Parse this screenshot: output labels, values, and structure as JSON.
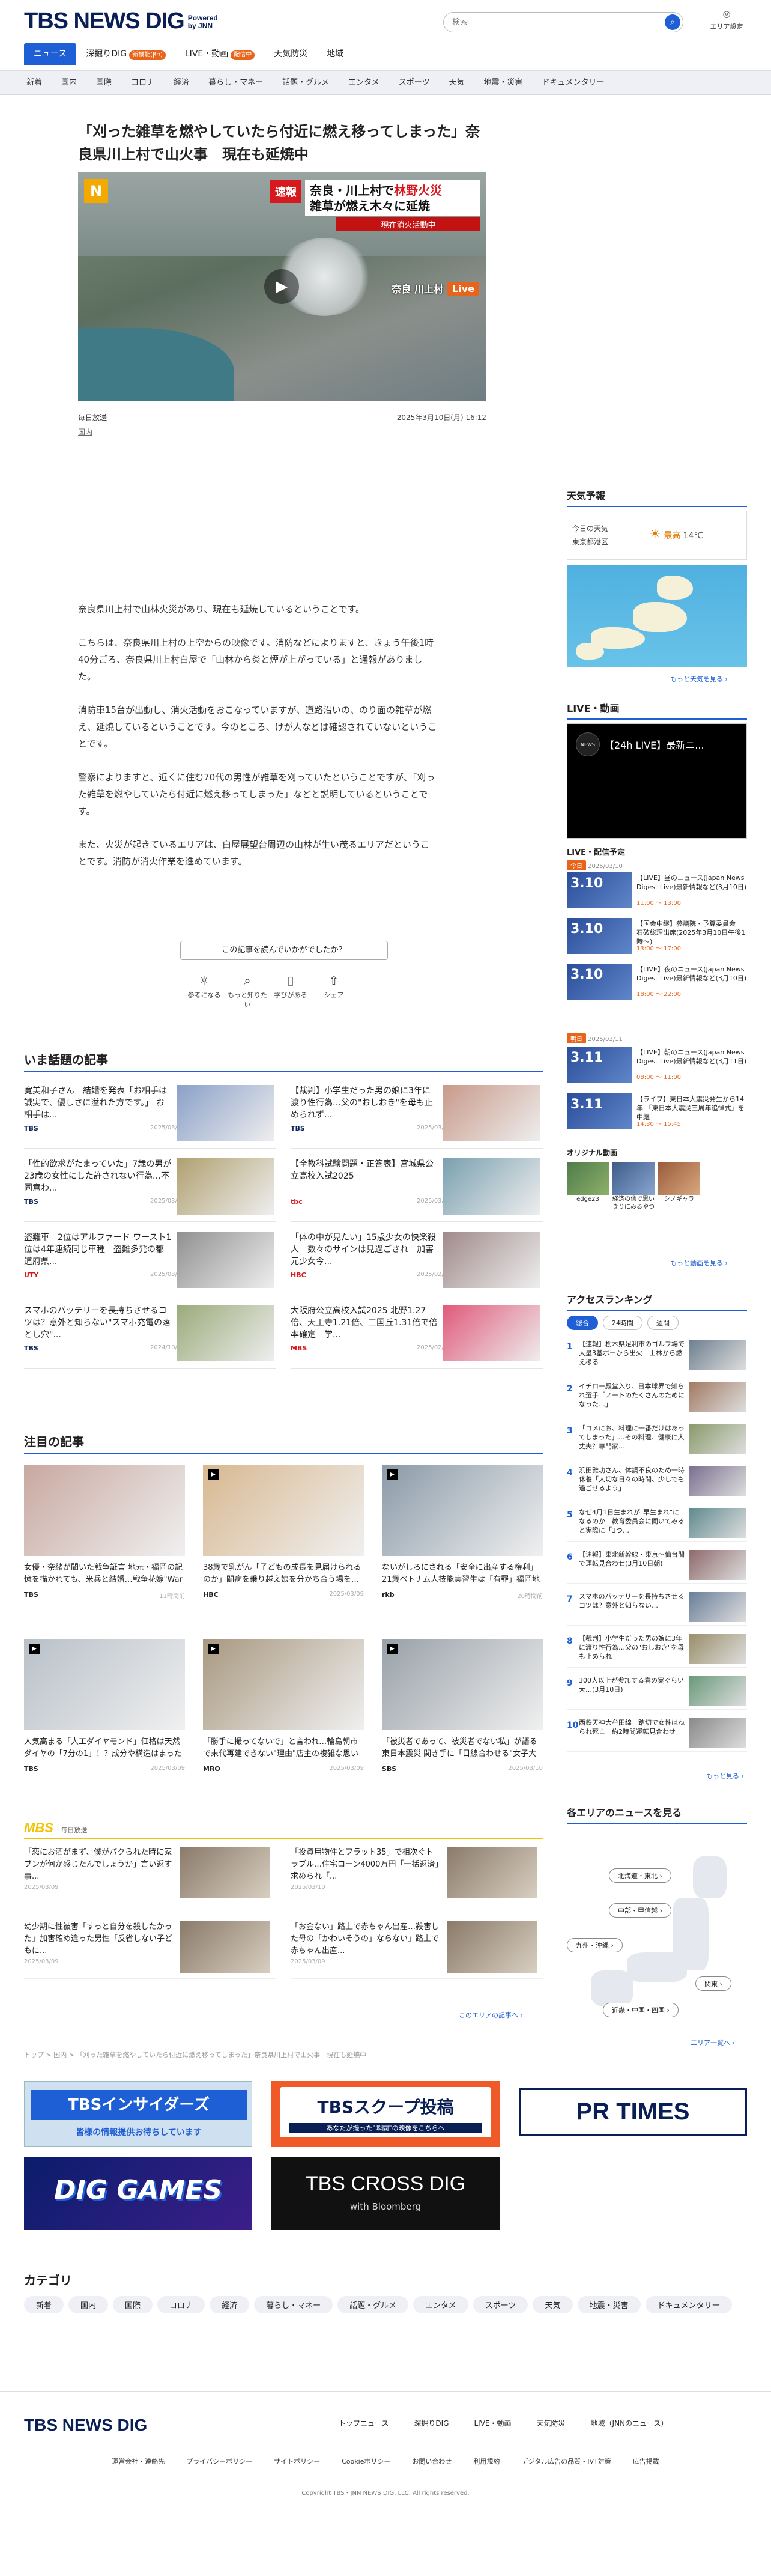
{
  "header": {
    "logo": "TBS NEWS DIG",
    "powered": "Powered",
    "powered_by": "by JNN",
    "search_placeholder": "検索",
    "area": "エリア設定"
  },
  "nav_main": [
    {
      "label": "ニュース"
    },
    {
      "label": "深掘りDIG",
      "badge": "新機能(βα)"
    },
    {
      "label": "LIVE・動画",
      "badge": "配信中"
    },
    {
      "label": "天気防災"
    },
    {
      "label": "地域"
    }
  ],
  "nav_sub": [
    "新着",
    "国内",
    "国際",
    "コロナ",
    "経済",
    "暮らし・マネー",
    "話題・グルメ",
    "エンタメ",
    "スポーツ",
    "天気",
    "地震・災害",
    "ドキュメンタリー"
  ],
  "article": {
    "title": "「刈った雑草を燃やしていたら付近に燃え移ってしまった」奈良県川上村で山火事　現在も延焼中",
    "video_caption_tag": "速報",
    "video_caption_line1a": "奈良・川上村で",
    "video_caption_line1b": "林野火災",
    "video_caption_line2": "雑草が燃え木々に延焼",
    "video_caption_line3": "現在消火活動中",
    "video_place": "奈良 川上村",
    "video_live": "Live",
    "source": "毎日放送",
    "date": "2025年3月10日(月) 16:12",
    "category": "国内",
    "paragraphs": [
      "奈良県川上村で山林火災があり、現在も延焼しているということです。",
      "こちらは、奈良県川上村の上空からの映像です。消防などによりますと、きょう午後1時40分ごろ、奈良県川上村白屋で「山林から炎と煙が上がっている」と通報がありました。",
      "消防車15台が出動し、消火活動をおこなっていますが、道路沿いの、のり面の雑草が燃え、延焼しているということです。今のところ、けが人などは確認されていないということです。",
      "警察によりますと、近くに住む70代の男性が雑草を刈っていたということですが、「刈った雑草を燃やしていたら付近に燃え移ってしまった」などと説明しているということです。",
      "また、火災が起きているエリアは、白屋展望台周辺の山林が生い茂るエリアだということです。消防が消火作業を進めています。"
    ],
    "feedback_q": "この記事を読んでいかがでしたか？",
    "feedback_opts": [
      "参考になる",
      "もっと知りたい",
      "学びがある",
      "シェア"
    ]
  },
  "sidebar": {
    "weather_title": "天気予報",
    "weather_today": "今日の天気",
    "weather_place": "東京都港区",
    "weather_high": "最高",
    "weather_temp": "14℃",
    "weather_more": "もっと天気を見る ›",
    "live_title": "LIVE・動画",
    "live_video": "【24h LIVE】最新ニ...",
    "sched_title": "LIVE・配信予定",
    "sched_day1": "今日",
    "sched_day1_date": "2025/03/10",
    "sched_day2": "明日",
    "sched_day2_date": "2025/03/11",
    "schedule": [
      {
        "date": "3.10",
        "text": "【LIVE】昼のニュース(Japan News Digest Live)最新情報など(3月10日)",
        "time": "11:00 〜 13:00"
      },
      {
        "date": "3.10",
        "text": "【国会中継】参議院・予算委員会　石破総理出席(2025年3月10日午後1時〜)",
        "time": "13:00 〜 17:00"
      },
      {
        "date": "3.10",
        "text": "【LIVE】夜のニュース(Japan News Digest Live)最新情報など(3月10日)",
        "time": "18:00 〜 22:00"
      },
      {
        "date": "3.11",
        "text": "【LIVE】朝のニュース(Japan News Digest Live)最新情報など(3月11日)",
        "time": "08:00 〜 11:00"
      },
      {
        "date": "3.11",
        "text": "【ライブ】東日本大震災発生から14年 「東日本大震災三周年追悼式」を中継",
        "time": "14:30 〜 15:45"
      }
    ],
    "orig_title": "オリジナル動画",
    "orig_labels": [
      "edge23",
      "経済の信で思いきりにみるやつ",
      "シノギャラ"
    ],
    "video_more": "もっと動画を見る ›",
    "rank_title": "アクセスランキング",
    "rank_tabs": [
      "総合",
      "24時間",
      "週間"
    ],
    "ranking": [
      "【速報】栃木県足利市のゴルフ場で大量3基ボーから出火　山林から燃え移る",
      "イチロー殿堂入り、日本球界で知られ選手「ノートのたくさんのためになった…」",
      "「コメにお、料理に一番だけはあってしまった」…その料理、健康に大丈夫？専門家…",
      "浜田雅功さん、体調不良のため一時休養「大切な日々の時間、少しでも過ごせるよう」",
      "なぜ4月1日生まれが\"早生まれ\"になるのか　教育委員会に聞いてみると実際に「3つ…",
      "【速報】東北新幹線・東京〜仙台間で運転見合わせ(3月10日朝)",
      "スマホのバッテリーを長持ちさせるコツは？意外と知らない…",
      "【裁判】小学生だった男の娘に3年に渡り性行為…父の\"おしおき\"を母も止められ",
      "300人以上が参加する春の実ぐらい大…(3月10日)",
      "西鉄天神大牟田線　踏切で女性はねられ死亡　約2時間運転見合わせ"
    ],
    "rank_more": "もっと見る ›",
    "area_title": "各エリアのニュースを見る",
    "area_pills": [
      "北海道・東北 ›",
      "中部・甲信越 ›",
      "九州・沖縄 ›",
      "関東 ›",
      "近畿・中国・四国 ›"
    ],
    "area_more": "エリア一覧へ ›"
  },
  "trending": {
    "title": "いま話題の記事",
    "items": [
      {
        "text": "寛美和子さん　結婚を発表「お相手は誠実で、優しさに溢れた方です。」 お相手は...",
        "src": "TBS",
        "date": "2025/03/09"
      },
      {
        "text": "【裁判】小学生だった男の娘に3年に渡り性行為…父の\"おしおき\"を母も止められず...",
        "src": "TBS",
        "date": "2025/03/09"
      },
      {
        "text": "「性的欲求がたまっていた」7歳の男が23歳の女性にした許されない行為…不同意わ...",
        "src": "TBS",
        "date": "2025/03/09"
      },
      {
        "text": "【全教科試験問題・正答表】宮城県公立高校入試2025",
        "src": "tbc",
        "date": "2025/03/04"
      },
      {
        "text": "盗難車　2位はアルファード ワースト1位は4年連続同じ車種　盗難多発の都道府県...",
        "src": "UTY",
        "date": "2025/03/07"
      },
      {
        "text": "「体の中が見たい」15歳少女の快楽殺人　数々のサインは見過ごされ　加害元少女今...",
        "src": "HBC",
        "date": "2025/02/24"
      },
      {
        "text": "スマホのバッテリーを長持ちさせるコツは？意外と知らない\"スマホ充電の落とし穴\"...",
        "src": "TBS",
        "date": "2024/10/27"
      },
      {
        "text": "大阪府公立高校入試2025 北野1.27倍、天王寺1.21倍、三国丘1.31倍で倍率確定　学...",
        "src": "MBS",
        "date": "2025/02/28"
      }
    ]
  },
  "featured": {
    "title": "注目の記事",
    "items": [
      {
        "text": "女優・奈緒が聞いた戦争証言 地元・福岡の記憶を描かれても、米兵と結婚…戦争花嫁\"War Bride\"と...",
        "src": "TBS",
        "date": "11時間前"
      },
      {
        "text": "38歳で乳がん「子どもの成長を見届けられるのか」闘病を乗り越え娘を分かち合う場を…子育て世代の...",
        "src": "HBC",
        "date": "2025/03/09"
      },
      {
        "text": "ないがしろにされる「安全に出産する権利」 21歳ベトナム人技能実習生は「有罪」福岡地裁判決があ...",
        "src": "rkb",
        "date": "20時間前"
      },
      {
        "text": "人気高まる「人工ダイヤモンド」価格は天然ダイヤの「7分の1」！？成分や構造はまったく同じ　一方...",
        "src": "TBS",
        "date": "2025/03/09"
      },
      {
        "text": "「勝手に撮ってないで」と言われ…輪島朝市で末代再建できない\"理由\"店主の複雑な思いと復興への...",
        "src": "MRO",
        "date": "2025/03/09"
      },
      {
        "text": "「被災者であって、被災者でない私」が語る東日本震災 関き手に「目線合わせる\"女子大学生の語り部...",
        "src": "SBS",
        "date": "2025/03/10"
      }
    ]
  },
  "mbs": {
    "label": "MBS",
    "sub": "毎日放送",
    "items": [
      {
        "text": "「恋にお酒がまず、僕がバクられた時に家ブンが何か感じたんでしょうか」言い返す事...",
        "date": "2025/03/09"
      },
      {
        "text": "「投資用物件とフラット35」で相次ぐトラブル…住宅ローン4000万円「一括返済」求められ「...",
        "date": "2025/03/10"
      },
      {
        "text": "幼少期に性被害「すっと自分を殺したかった」加害確め違った男性「反省しない子どもに...",
        "date": "2025/03/09"
      },
      {
        "text": "「お金ない」路上で赤ちゃん出産…殺害した母の「かわいそうの」ならない」路上で赤ちゃん出産...",
        "date": "2025/03/09"
      }
    ],
    "more": "このエリアの記事へ ›"
  },
  "breadcrumb": "トップ > 国内 > 「刈った雑草を燃やしていたら付近に燃え移ってしまった」奈良県川上村で山火事　現在も延焼中",
  "banners": [
    {
      "t1": "TBSインサイダーズ",
      "t2": "皆様の情報提供お待ちしています"
    },
    {
      "t1": "TBSスクープ投稿",
      "t2": "あなたが撮った\"瞬間\"の映像をこちらへ"
    },
    {
      "t1": "PR TIMES"
    },
    {
      "t1": "DIG GAMES"
    },
    {
      "t1": "TBS CROSS DIG",
      "t2": "with Bloomberg"
    }
  ],
  "categories": {
    "title": "カテゴリ",
    "items": [
      "新着",
      "国内",
      "国際",
      "コロナ",
      "経済",
      "暮らし・マネー",
      "話題・グルメ",
      "エンタメ",
      "スポーツ",
      "天気",
      "地震・災害",
      "ドキュメンタリー"
    ]
  },
  "footer": {
    "nav": [
      "トップニュース",
      "深掘りDIG",
      "LIVE・動画",
      "天気防災",
      "地域（JNNのニュース）"
    ],
    "links": [
      "運営会社・連絡先",
      "プライバシーポリシー",
      "サイトポリシー",
      "Cookieポリシー",
      "お問い合わせ",
      "利用規約",
      "デジタル広告の品質・IVT対策",
      "広告掲載"
    ],
    "copyright": "Copyright TBS・JNN NEWS DIG, LLC. All rights reserved."
  }
}
